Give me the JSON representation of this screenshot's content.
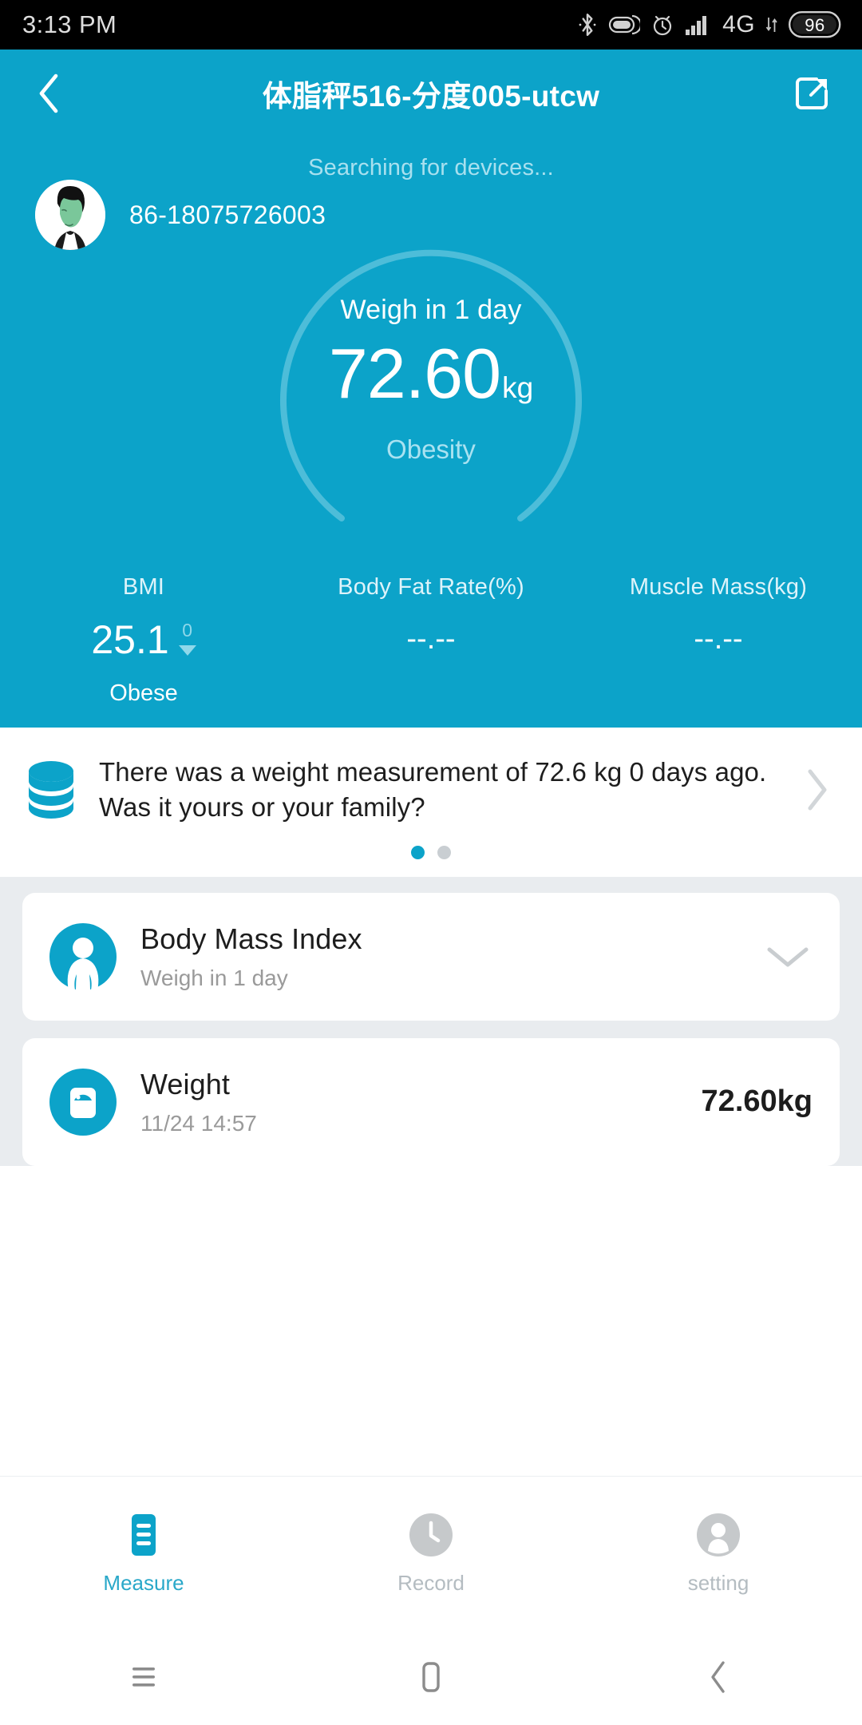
{
  "status_bar": {
    "time": "3:13 PM",
    "battery_percent": "96",
    "network": "4G",
    "icons": [
      "bluetooth-icon",
      "dnd-icon",
      "alarm-icon",
      "signal-icon",
      "network-4g-icon",
      "battery-icon"
    ]
  },
  "app_bar": {
    "title": "体脂秤516-分度005-utcw",
    "back_icon": "back-chevron-icon",
    "share_icon": "share-icon"
  },
  "hero": {
    "searching_status": "Searching for devices...",
    "account": "86-18075726003",
    "gauge": {
      "subtitle": "Weigh in 1 day",
      "value": "72.60",
      "unit": "kg",
      "state": "Obesity",
      "ring_color": "#4dbdd9"
    },
    "metrics": [
      {
        "label": "BMI",
        "value": "25.1",
        "delta": "0",
        "delta_direction": "down",
        "state": "Obese"
      },
      {
        "label": "Body Fat Rate(%)",
        "value": "--.--",
        "delta": "",
        "delta_direction": "",
        "state": ""
      },
      {
        "label": "Muscle Mass(kg)",
        "value": "--.--",
        "delta": "",
        "delta_direction": "",
        "state": ""
      }
    ],
    "background_color": "#0ca3c9"
  },
  "notice": {
    "icon": "database-stack-icon",
    "message": "There was a weight measurement of 72.6 kg 0 days ago. Was it yours or your family?",
    "arrow_icon": "chevron-right-icon",
    "page_dots": 2,
    "active_dot": 0
  },
  "cards": [
    {
      "icon": "body-silhouette-icon",
      "title": "Body Mass Index",
      "subtitle": "Weigh in 1 day",
      "value": "",
      "trailing_icon": "chevron-down-icon"
    },
    {
      "icon": "weight-scale-icon",
      "title": "Weight",
      "subtitle": "11/24 14:57",
      "value": "72.60kg",
      "trailing_icon": ""
    }
  ],
  "tabs": [
    {
      "label": "Measure",
      "icon": "list-document-icon",
      "active": true
    },
    {
      "label": "Record",
      "icon": "clock-icon",
      "active": false
    },
    {
      "label": "setting",
      "icon": "person-icon",
      "active": false
    }
  ],
  "system_nav": {
    "recents_icon": "menu-icon",
    "home_icon": "home-square-icon",
    "back_icon": "back-chevron-icon"
  },
  "theme": {
    "accent": "#0ca3c9",
    "accent_light": "#a9e2f1",
    "page_bg": "#e9ecef",
    "card_bg": "#ffffff",
    "text_dark": "#1d1d1d",
    "text_muted": "#9a9a9a"
  }
}
